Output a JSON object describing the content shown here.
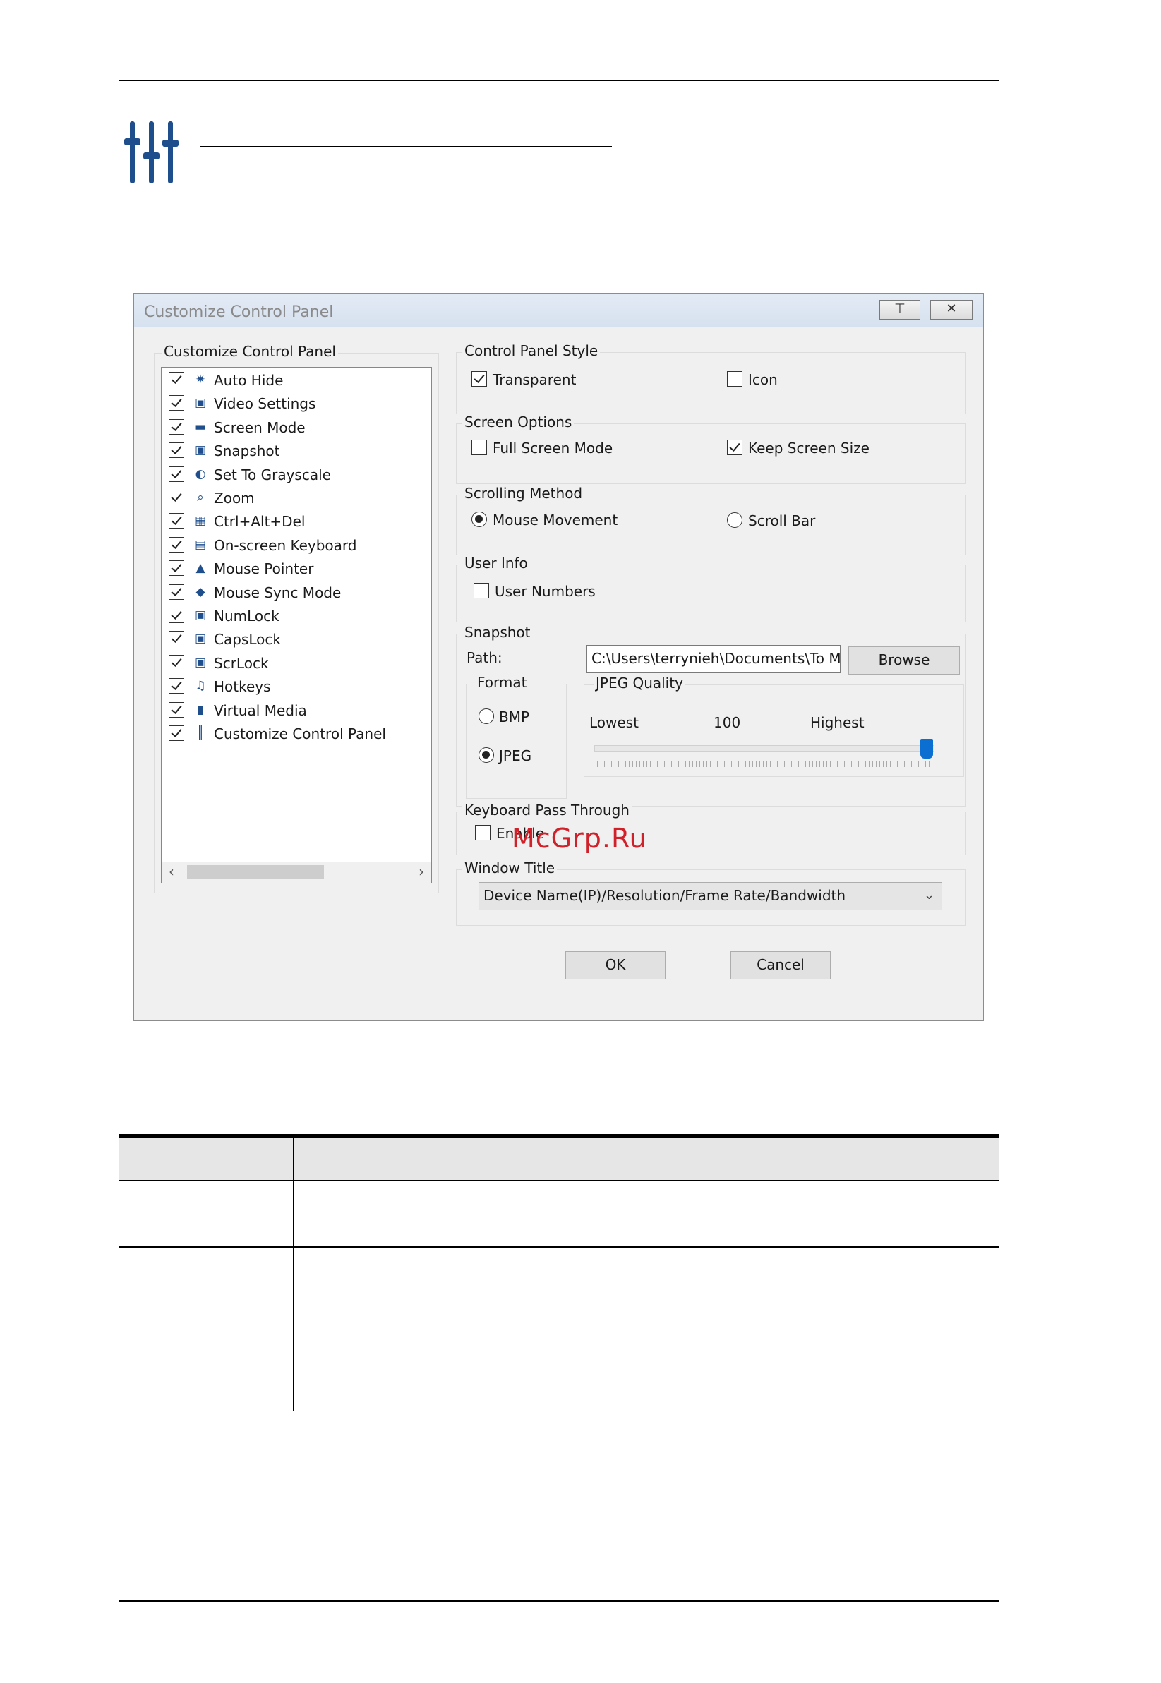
{
  "dialog": {
    "title": "Customize Control Panel",
    "pin_glyph": "⊤",
    "close_glyph": "✕",
    "list_group_label": "Customize Control Panel",
    "list_items": [
      {
        "label": "Auto Hide",
        "checked": true,
        "icon": "pin-icon"
      },
      {
        "label": "Video Settings",
        "checked": true,
        "icon": "video-settings-icon"
      },
      {
        "label": "Screen Mode",
        "checked": true,
        "icon": "screen-mode-icon"
      },
      {
        "label": "Snapshot",
        "checked": true,
        "icon": "camera-icon"
      },
      {
        "label": "Set To Grayscale",
        "checked": true,
        "icon": "grayscale-icon"
      },
      {
        "label": "Zoom",
        "checked": true,
        "icon": "zoom-icon"
      },
      {
        "label": "Ctrl+Alt+Del",
        "checked": true,
        "icon": "ctrl-alt-del-icon"
      },
      {
        "label": "On-screen Keyboard",
        "checked": true,
        "icon": "keyboard-icon"
      },
      {
        "label": "Mouse Pointer",
        "checked": true,
        "icon": "mouse-pointer-icon"
      },
      {
        "label": "Mouse Sync Mode",
        "checked": true,
        "icon": "mouse-sync-icon"
      },
      {
        "label": "NumLock",
        "checked": true,
        "icon": "lock-icon"
      },
      {
        "label": "CapsLock",
        "checked": true,
        "icon": "lock-icon"
      },
      {
        "label": "ScrLock",
        "checked": true,
        "icon": "lock-icon"
      },
      {
        "label": "Hotkeys",
        "checked": true,
        "icon": "hotkeys-icon"
      },
      {
        "label": "Virtual Media",
        "checked": true,
        "icon": "virtual-media-icon"
      },
      {
        "label": "Customize Control Panel",
        "checked": true,
        "icon": "sliders-icon"
      }
    ],
    "control_panel_style": {
      "label": "Control Panel Style",
      "transparent": "Transparent",
      "transparent_checked": true,
      "icon": "Icon",
      "icon_checked": false
    },
    "screen_options": {
      "label": "Screen Options",
      "full_screen": "Full Screen Mode",
      "full_screen_checked": false,
      "keep_size": "Keep Screen Size",
      "keep_size_checked": true
    },
    "scrolling_method": {
      "label": "Scrolling Method",
      "mouse_movement": "Mouse Movement",
      "scroll_bar": "Scroll Bar",
      "selected": "Mouse Movement"
    },
    "user_info": {
      "label": "User Info",
      "user_numbers": "User Numbers",
      "checked": false
    },
    "snapshot": {
      "label": "Snapshot",
      "path_label": "Path:",
      "path_value": "C:\\Users\\terrynieh\\Documents\\To Me",
      "browse": "Browse",
      "format_label": "Format",
      "bmp": "BMP",
      "jpeg": "JPEG",
      "format_selected": "JPEG",
      "quality_label": "JPEG Quality",
      "lowest": "Lowest",
      "quality_value": "100",
      "highest": "Highest",
      "quality_fraction": 1.0
    },
    "keyboard_pass_through": {
      "label": "Keyboard Pass Through",
      "enable": "Enable",
      "checked": false
    },
    "window_title": {
      "label": "Window Title",
      "selected": "Device Name(IP)/Resolution/Frame Rate/Bandwidth"
    },
    "ok": "OK",
    "cancel": "Cancel"
  },
  "watermark": "McGrp.Ru",
  "colors": {
    "icon_blue": "#1f4e8c",
    "slider_thumb": "#0a6fd1"
  }
}
